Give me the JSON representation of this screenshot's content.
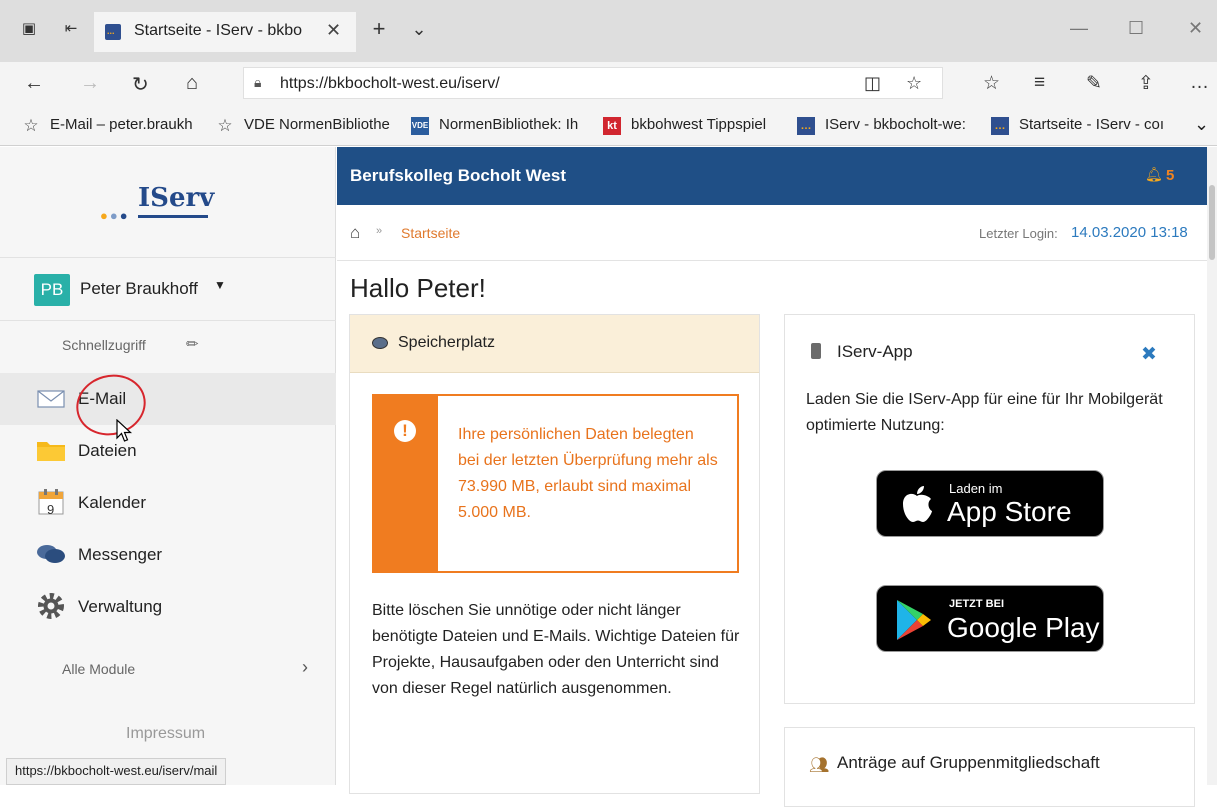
{
  "browser": {
    "tab_title": "Startseite - IServ - bkbo",
    "tab_close": "✕",
    "new_tab": "+",
    "tab_list": "⌄",
    "url": "https://bkbocholt-west.eu/iserv/",
    "minimize": "—",
    "maximize": "☐",
    "close": "✕",
    "favorites": [
      {
        "label": "E-Mail – peter.braukh",
        "icon": "star-icon"
      },
      {
        "label": "VDE NormenBibliothe",
        "icon": "star-icon"
      },
      {
        "label": "NormenBibliothek: Ih",
        "icon": "vde-icon"
      },
      {
        "label": "bkbohwest Tippspiel",
        "icon": "kt-icon"
      },
      {
        "label": "IServ - bkbocholt-we:",
        "icon": "iserv-icon"
      },
      {
        "label": "Startseite - IServ - coı",
        "icon": "iserv-icon"
      }
    ],
    "fav_more": "⌄",
    "status_url": "https://bkbocholt-west.eu/iserv/mail"
  },
  "sidebar": {
    "logo": "IServ",
    "avatar_initials": "PB",
    "user_name": "Peter Braukhoff",
    "quick_access": "Schnellzugriff",
    "items": [
      {
        "label": "E-Mail",
        "icon": "mail-icon"
      },
      {
        "label": "Dateien",
        "icon": "folder-icon"
      },
      {
        "label": "Kalender",
        "icon": "calendar-icon"
      },
      {
        "label": "Messenger",
        "icon": "chat-icon"
      },
      {
        "label": "Verwaltung",
        "icon": "gear-icon"
      }
    ],
    "calendar_day": "9",
    "all_modules": "Alle Module",
    "impressum": "Impressum"
  },
  "header": {
    "school": "Berufskolleg Bocholt West",
    "notifications": "5"
  },
  "breadcrumb": {
    "separator": "»",
    "current": "Startseite",
    "last_login_label": "Letzter Login:",
    "last_login_value": "14.03.2020 13:18"
  },
  "main": {
    "greeting": "Hallo Peter!",
    "storage": {
      "title": "Speicherplatz",
      "warning": "Ihre persönlichen Daten belegten bei der letzten Überprüfung mehr als 73.990 MB, erlaubt sind maximal 5.000 MB.",
      "body": "Bitte löschen Sie unnötige oder nicht länger benötigte Dateien und E-Mails. Wichtige Dateien für Projekte, Hausaufgaben oder den Unterricht sind von dieser Regel natürlich ausgenommen."
    },
    "app": {
      "title": "IServ-App",
      "text": "Laden Sie die IServ-App für eine für Ihr Mobilgerät optimierte Nutzung:",
      "appstore_small": "Laden im",
      "appstore_big": "App Store",
      "gplay_small": "JETZT BEI",
      "gplay_big": "Google Play"
    },
    "requests_title": "Anträge auf Gruppenmitgliedschaft"
  },
  "colors": {
    "header": "#1f4f86",
    "accent": "#f07c20",
    "link": "#2c7abe"
  }
}
